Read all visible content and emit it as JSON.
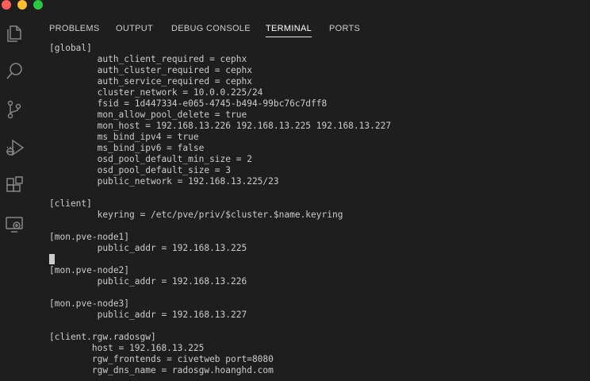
{
  "panel": {
    "tabs": [
      {
        "label": "PROBLEMS"
      },
      {
        "label": "OUTPUT"
      },
      {
        "label": "DEBUG CONSOLE"
      },
      {
        "label": "TERMINAL"
      },
      {
        "label": "PORTS"
      }
    ],
    "active_tab": "TERMINAL"
  },
  "activity_bar": {
    "icons": [
      "explorer-icon",
      "search-icon",
      "source-control-icon",
      "run-debug-icon",
      "extensions-icon",
      "remote-explorer-icon"
    ]
  },
  "terminal": {
    "lines": [
      "[global]",
      "         auth_client_required = cephx",
      "         auth_cluster_required = cephx",
      "         auth_service_required = cephx",
      "         cluster_network = 10.0.0.225/24",
      "         fsid = 1d447334-e065-4745-b494-99bc76c7dff8",
      "         mon_allow_pool_delete = true",
      "         mon_host = 192.168.13.226 192.168.13.225 192.168.13.227",
      "         ms_bind_ipv4 = true",
      "         ms_bind_ipv6 = false",
      "         osd_pool_default_min_size = 2",
      "         osd_pool_default_size = 3",
      "         public_network = 192.168.13.225/23",
      "",
      "[client]",
      "         keyring = /etc/pve/priv/$cluster.$name.keyring",
      "",
      "[mon.pve-node1]",
      "         public_addr = 192.168.13.225",
      "",
      "[mon.pve-node2]",
      "         public_addr = 192.168.13.226",
      "",
      "[mon.pve-node3]",
      "         public_addr = 192.168.13.227",
      "",
      "[client.rgw.radosgw]",
      "        host = 192.168.13.225",
      "        rgw_frontends = civetweb port=8080",
      "        rgw_dns_name = radosgw.hoanghd.com"
    ],
    "cursor_line": 19
  },
  "colors": {
    "background": "#1e1e1e",
    "text": "#cccccc",
    "icon": "#858585"
  }
}
